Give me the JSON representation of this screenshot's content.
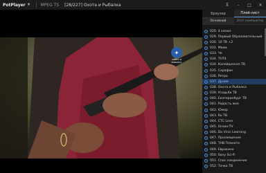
{
  "titlebar": {
    "app_name": "PotPlayer",
    "format": "MPEG TS",
    "now_playing": "[28/227] Охота и Рыбалка",
    "controls": [
      "pin-icon",
      "minimize-icon",
      "maximize-icon",
      "close-icon"
    ]
  },
  "video": {
    "logo_caption": "ОХОТА И РЫБАЛКА"
  },
  "panel": {
    "tabs": [
      "Браузер",
      "Плей-лист"
    ],
    "active_tab": 1,
    "subtabs": [
      "Основной",
      "Этот компьютер"
    ],
    "active_subtab": 0,
    "current_index": 9,
    "items": [
      "020. 4 канал",
      "029. Первый Образовательный",
      "030. 10 ТВ +2",
      "031. Мама",
      "033. Че",
      "034. ТНТ4",
      "034. Калейдоскоп ТВ",
      "035. Сарафан",
      "036. Ретро",
      "037. Драйв",
      "038. Охота и Рыбалка",
      "039. Усадьба ТВ",
      "040. Екатеринбург ТВ",
      "041. Радость моя",
      "042. Юмор",
      "043. Ru ТВ",
      "044. СТС Love",
      "045. Ocean-TV",
      "046. Da Vinci Learning",
      "047. Просвещение",
      "048. ТНВ Планета",
      "049. Еврокино",
      "050. Sony Sci-Fi",
      "051. Спас.соединение",
      "052. Точка ТВ"
    ]
  },
  "colors": {
    "titlebar_bg": "#1c1c1c",
    "panel_bg": "#1a1a1a",
    "highlight_bg": "#223b5e",
    "highlight_text": "#8fbfff",
    "accent": "#4a90d9"
  }
}
